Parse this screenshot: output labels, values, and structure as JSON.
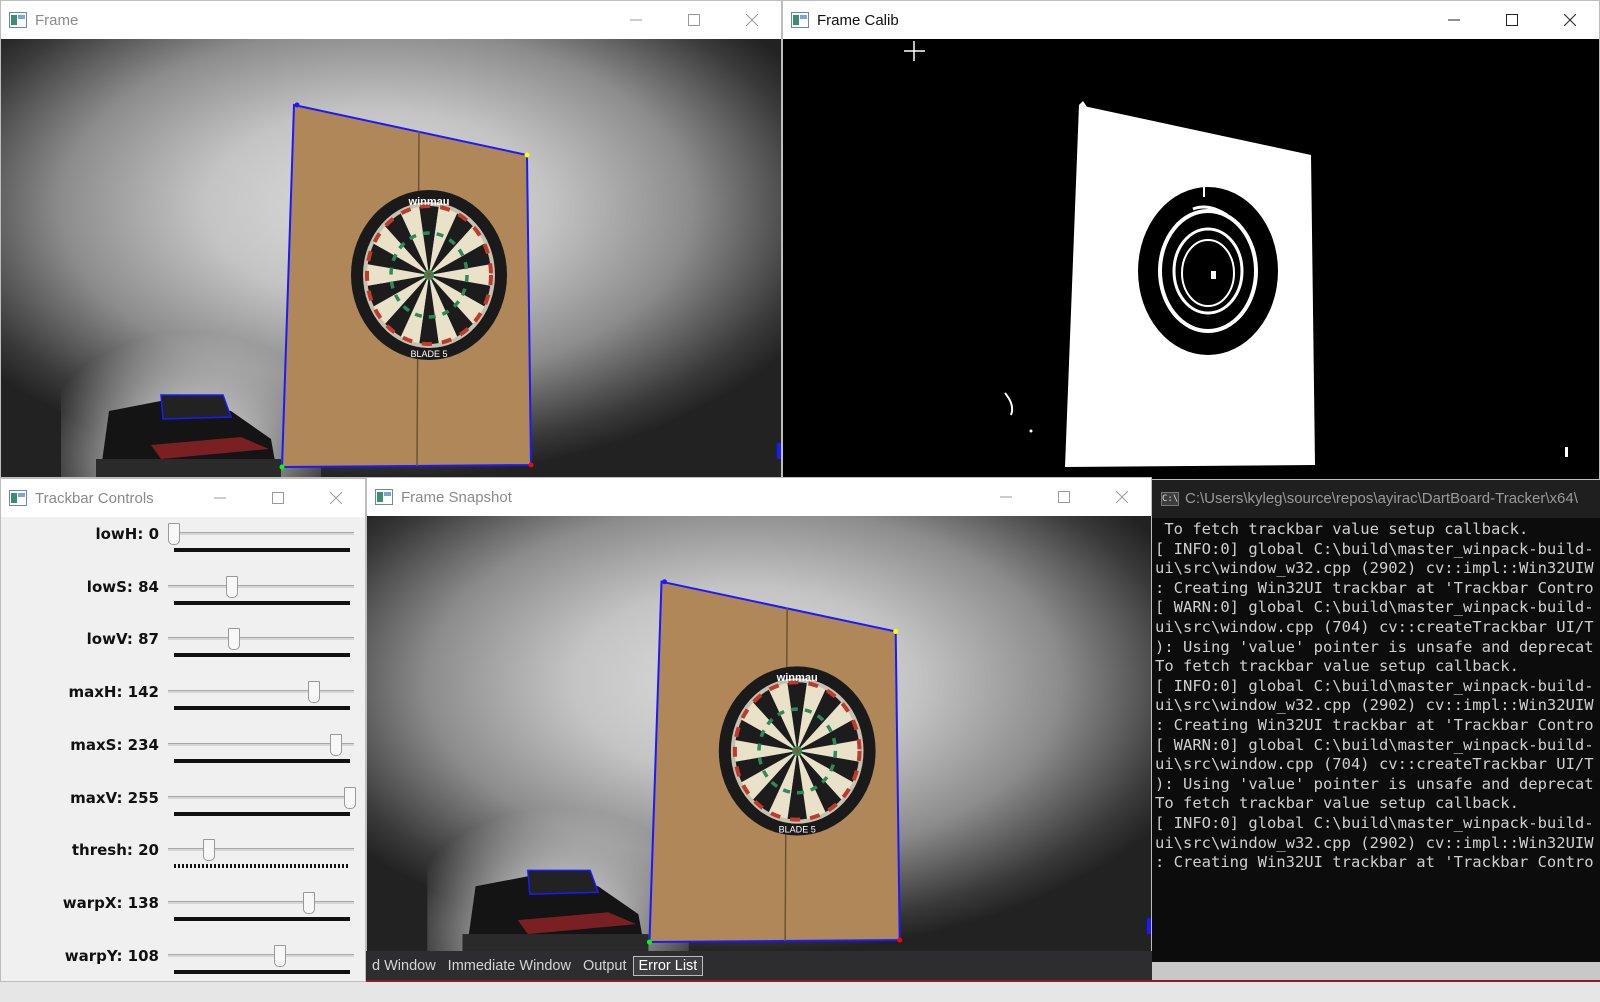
{
  "windows": {
    "frame": {
      "title": "Frame"
    },
    "calib": {
      "title": "Frame Calib"
    },
    "trackbar": {
      "title": "Trackbar Controls"
    },
    "snapshot": {
      "title": "Frame Snapshot"
    },
    "console": {
      "title": "C:\\Users\\kyleg\\source\\repos\\ayirac\\DartBoard-Tracker\\x64\\"
    }
  },
  "dartboard": {
    "brand": "winmau",
    "model": "BLADE 5"
  },
  "trackbars": [
    {
      "label": "lowH: 0",
      "name": "lowH",
      "value": 0,
      "max": 179,
      "fine": false
    },
    {
      "label": "lowS: 84",
      "name": "lowS",
      "value": 84,
      "max": 255,
      "fine": false
    },
    {
      "label": "lowV: 87",
      "name": "lowV",
      "value": 87,
      "max": 255,
      "fine": false
    },
    {
      "label": "maxH: 142",
      "name": "maxH",
      "value": 142,
      "max": 179,
      "fine": false
    },
    {
      "label": "maxS: 234",
      "name": "maxS",
      "value": 234,
      "max": 255,
      "fine": false
    },
    {
      "label": "maxV: 255",
      "name": "maxV",
      "value": 255,
      "max": 255,
      "fine": false
    },
    {
      "label": "thresh: 20",
      "name": "thresh",
      "value": 20,
      "max": 100,
      "fine": true
    },
    {
      "label": "warpX: 138",
      "name": "warpX",
      "value": 138,
      "max": 180,
      "fine": false
    },
    {
      "label": "warpY: 108",
      "name": "warpY",
      "value": 108,
      "max": 180,
      "fine": false
    }
  ],
  "console_lines": [
    " To fetch trackbar value setup callback.",
    "[ INFO:0] global C:\\build\\master_winpack-build-",
    "ui\\src\\window_w32.cpp (2902) cv::impl::Win32UIW",
    ": Creating Win32UI trackbar at 'Trackbar Contro",
    "[ WARN:0] global C:\\build\\master_winpack-build-",
    "ui\\src\\window.cpp (704) cv::createTrackbar UI/T",
    "): Using 'value' pointer is unsafe and deprecat",
    "To fetch trackbar value setup callback.",
    "[ INFO:0] global C:\\build\\master_winpack-build-",
    "ui\\src\\window_w32.cpp (2902) cv::impl::Win32UIW",
    ": Creating Win32UI trackbar at 'Trackbar Contro",
    "[ WARN:0] global C:\\build\\master_winpack-build-",
    "ui\\src\\window.cpp (704) cv::createTrackbar UI/T",
    "): Using 'value' pointer is unsafe and deprecat",
    "To fetch trackbar value setup callback.",
    "[ INFO:0] global C:\\build\\master_winpack-build-",
    "ui\\src\\window_w32.cpp (2902) cv::impl::Win32UIW",
    ": Creating Win32UI trackbar at 'Trackbar Contro"
  ],
  "vs_tabs": [
    "d Window",
    "Immediate Window",
    "Output",
    "Error List"
  ],
  "vs_active_tab": "Error List",
  "colors": {
    "contour": "#1a1aff",
    "board": "#b08758",
    "console_bg": "#0c0c0c"
  }
}
